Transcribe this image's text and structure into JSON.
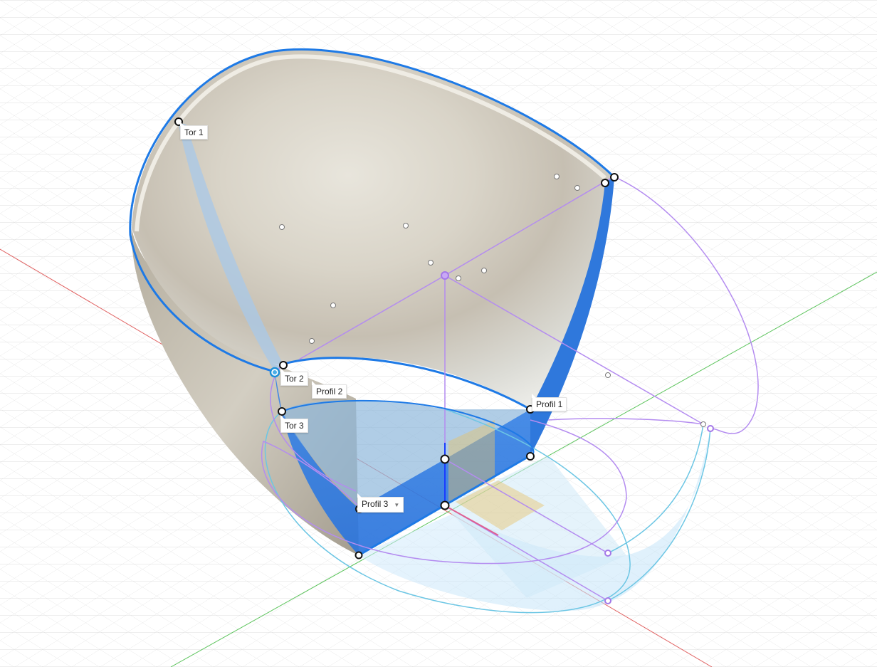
{
  "viewport": {
    "labels": {
      "tor1": "Tor 1",
      "tor2": "Tor 2",
      "tor3": "Tor 3",
      "profil1": "Profil 1",
      "profil2": "Profil 2",
      "profil3": "Profil 3"
    }
  },
  "colors": {
    "background": "#ffffff",
    "grid": "#d9d9d9",
    "x_axis": "#e06060",
    "y_axis": "#5cc45c",
    "z_axis": "#1a3cff",
    "selection_blue": "#1e7ae6",
    "surface_blue": "#2a7be4",
    "rail_purple": "#b48cf0",
    "guide_cyan": "#6cc6e4",
    "plane_yellow": "#e7c46a",
    "shell_tan": "#cbc6ba"
  },
  "icons": {
    "profil3_dropdown": "dropdown-triangle-icon"
  }
}
